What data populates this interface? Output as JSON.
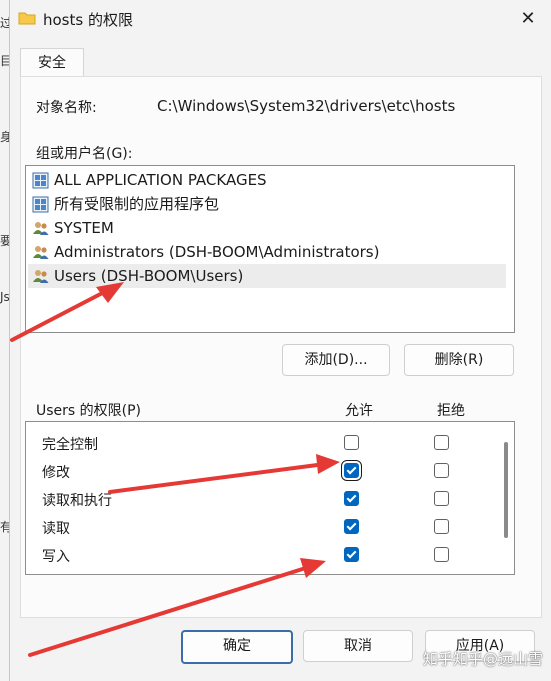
{
  "background": {
    "chars": [
      "过",
      "目",
      "身",
      "要",
      "Js",
      "有"
    ]
  },
  "window": {
    "title": "hosts 的权限",
    "close_glyph": "✕"
  },
  "tabs": [
    {
      "label": "安全"
    }
  ],
  "object": {
    "label": "对象名称:",
    "value": "C:\\Windows\\System32\\drivers\\etc\\hosts"
  },
  "groups": {
    "label": "组或用户名(G):",
    "items": [
      {
        "name": "ALL APPLICATION PACKAGES",
        "icon": "packages-icon"
      },
      {
        "name": "所有受限制的应用程序包",
        "icon": "packages-icon"
      },
      {
        "name": "SYSTEM",
        "icon": "users-icon"
      },
      {
        "name": "Administrators (DSH-BOOM\\Administrators)",
        "icon": "users-icon"
      },
      {
        "name": "Users (DSH-BOOM\\Users)",
        "icon": "users-icon",
        "selected": true
      }
    ]
  },
  "buttons": {
    "add": "添加(D)...",
    "remove": "删除(R)",
    "ok": "确定",
    "cancel": "取消",
    "apply": "应用(A)"
  },
  "permissions": {
    "label": "Users 的权限(P)",
    "allow_header": "允许",
    "deny_header": "拒绝",
    "rows": [
      {
        "name": "完全控制",
        "allow": false,
        "deny": false
      },
      {
        "name": "修改",
        "allow": true,
        "deny": false,
        "focused": true
      },
      {
        "name": "读取和执行",
        "allow": true,
        "deny": false
      },
      {
        "name": "读取",
        "allow": true,
        "deny": false
      },
      {
        "name": "写入",
        "allow": true,
        "deny": false
      }
    ]
  },
  "annotation_color": "#e53935",
  "watermark": "知乎知乎@远山雪"
}
